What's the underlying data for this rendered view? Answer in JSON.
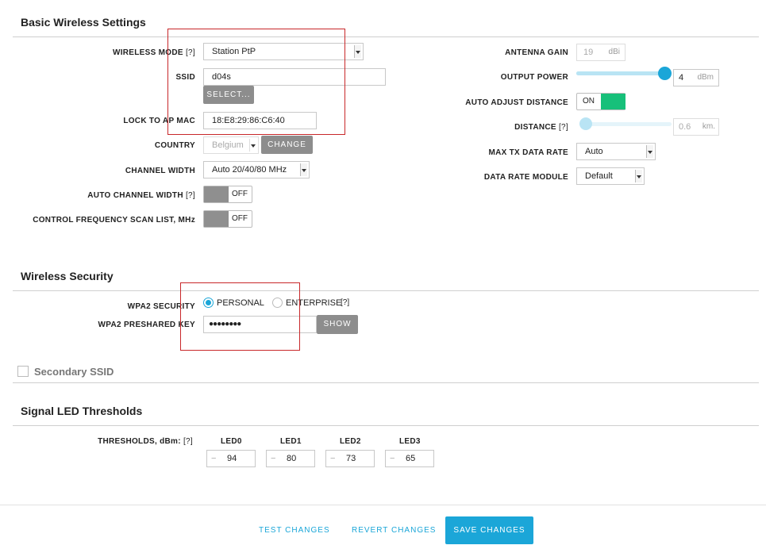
{
  "basic": {
    "title": "Basic Wireless Settings",
    "wireless_mode": {
      "label": "WIRELESS MODE",
      "help": "[?]",
      "value": "Station PtP"
    },
    "ssid": {
      "label": "SSID",
      "value": "d04s",
      "select_btn": "SELECT..."
    },
    "lock_ap": {
      "label": "LOCK TO AP MAC",
      "value": "18:E8:29:86:C6:40"
    },
    "country": {
      "label": "COUNTRY",
      "value": "Belgium",
      "change_btn": "CHANGE"
    },
    "channel_width": {
      "label": "CHANNEL WIDTH",
      "value": "Auto 20/40/80 MHz"
    },
    "auto_channel_width": {
      "label": "AUTO CHANNEL WIDTH",
      "help": "[?]",
      "state": "OFF"
    },
    "scan_list": {
      "label": "CONTROL FREQUENCY SCAN LIST, MHz",
      "state": "OFF"
    },
    "antenna_gain": {
      "label": "ANTENNA GAIN",
      "value": "19",
      "unit": "dBi"
    },
    "output_power": {
      "label": "OUTPUT POWER",
      "value": "4",
      "unit": "dBm",
      "slider_fraction": 1.0
    },
    "auto_adjust": {
      "label": "AUTO ADJUST DISTANCE",
      "state": "ON"
    },
    "distance": {
      "label": "DISTANCE",
      "help": "[?]",
      "value": "0.6",
      "unit": "km.",
      "slider_fraction": 0.0
    },
    "max_tx": {
      "label": "MAX TX DATA RATE",
      "value": "Auto"
    },
    "data_rate_module": {
      "label": "DATA RATE MODULE",
      "value": "Default"
    }
  },
  "security": {
    "title": "Wireless Security",
    "wpa2": {
      "label": "WPA2 SECURITY",
      "personal": "PERSONAL",
      "enterprise": "ENTERPRISE",
      "help": "[?]",
      "selected": "PERSONAL"
    },
    "psk": {
      "label": "WPA2 PRESHARED KEY",
      "value": "●●●●●●●●",
      "show_btn": "SHOW"
    }
  },
  "secondary": {
    "title": "Secondary SSID",
    "checked": false
  },
  "led": {
    "title": "Signal LED Thresholds",
    "label": "THRESHOLDS, dBm:",
    "help": "[?]",
    "items": [
      {
        "name": "LED0",
        "prefix": "−",
        "value": "94"
      },
      {
        "name": "LED1",
        "prefix": "−",
        "value": "80"
      },
      {
        "name": "LED2",
        "prefix": "−",
        "value": "73"
      },
      {
        "name": "LED3",
        "prefix": "−",
        "value": "65"
      }
    ]
  },
  "footer": {
    "test": "TEST CHANGES",
    "revert": "REVERT CHANGES",
    "save": "SAVE CHANGES"
  },
  "colors": {
    "accent": "#1ba6d8",
    "toggle_on": "#17c07a",
    "annotation": "#c8282a"
  }
}
